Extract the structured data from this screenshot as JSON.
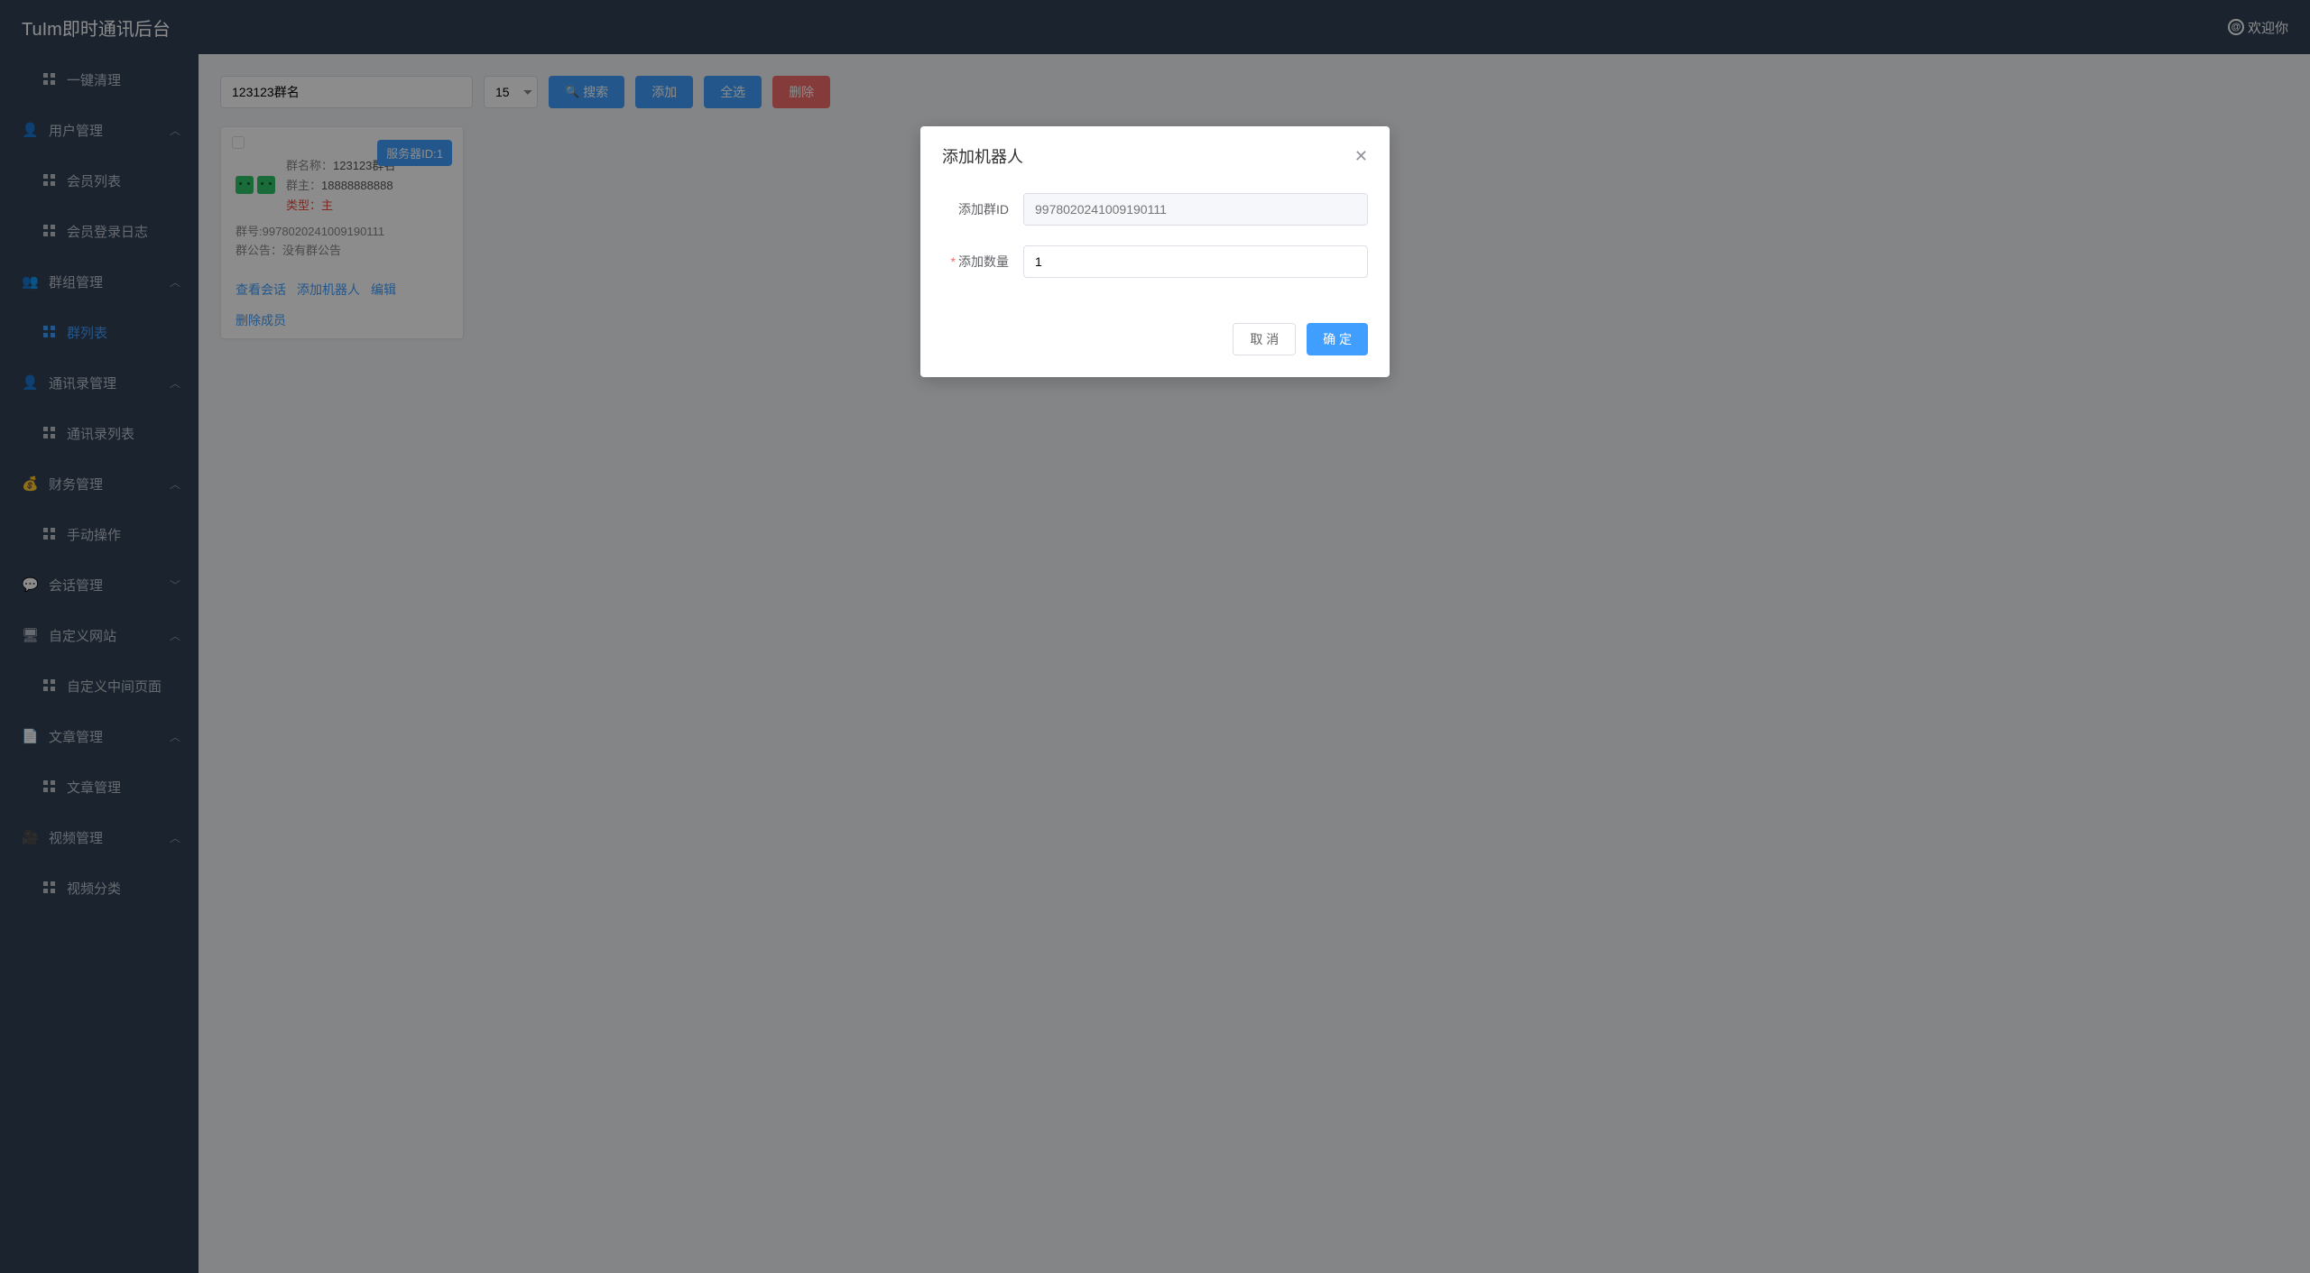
{
  "header": {
    "title": "TuIm即时通讯后台",
    "welcome": "欢迎你"
  },
  "sidebar": {
    "items": [
      {
        "type": "sub",
        "label": "一键清理",
        "name": "one-click-clean"
      },
      {
        "type": "group",
        "label": "用户管理",
        "name": "user-mgmt",
        "arrow": "︿"
      },
      {
        "type": "sub",
        "label": "会员列表",
        "name": "member-list"
      },
      {
        "type": "sub",
        "label": "会员登录日志",
        "name": "member-login-log"
      },
      {
        "type": "group",
        "label": "群组管理",
        "name": "group-mgmt",
        "arrow": "︿"
      },
      {
        "type": "sub",
        "label": "群列表",
        "name": "group-list",
        "active": true
      },
      {
        "type": "group",
        "label": "通讯录管理",
        "name": "contacts-mgmt",
        "arrow": "︿"
      },
      {
        "type": "sub",
        "label": "通讯录列表",
        "name": "contacts-list"
      },
      {
        "type": "group",
        "label": "财务管理",
        "name": "finance-mgmt",
        "arrow": "︿"
      },
      {
        "type": "sub",
        "label": "手动操作",
        "name": "manual-op"
      },
      {
        "type": "group",
        "label": "会话管理",
        "name": "session-mgmt",
        "arrow": "﹀"
      },
      {
        "type": "group",
        "label": "自定义网站",
        "name": "custom-site",
        "arrow": "︿"
      },
      {
        "type": "sub",
        "label": "自定义中间页面",
        "name": "custom-mid-page"
      },
      {
        "type": "group",
        "label": "文章管理",
        "name": "article-mgmt",
        "arrow": "︿"
      },
      {
        "type": "sub",
        "label": "文章管理",
        "name": "article-mgmt-sub"
      },
      {
        "type": "group",
        "label": "视频管理",
        "name": "video-mgmt",
        "arrow": "︿"
      },
      {
        "type": "sub",
        "label": "视频分类",
        "name": "video-category"
      }
    ]
  },
  "toolbar": {
    "search_value": "123123群名",
    "page_size": "15",
    "search_label": "搜索",
    "add_label": "添加",
    "select_all_label": "全选",
    "delete_label": "删除"
  },
  "card": {
    "server_badge": "服务器ID:1",
    "group_name_label": "群名称：",
    "group_name_value": "123123群名",
    "owner_label": "群主：",
    "owner_value": "18888888888",
    "type_label": "类型：",
    "type_value": "主",
    "id_label": "群号:",
    "id_value": "9978020241009190111",
    "notice_label": "群公告：",
    "notice_value": "没有群公告",
    "actions": {
      "view_chat": "查看会话",
      "add_robot": "添加机器人",
      "edit": "编辑",
      "remove_member": "删除成员"
    }
  },
  "modal": {
    "title": "添加机器人",
    "group_id_label": "添加群ID",
    "group_id_value": "9978020241009190111",
    "count_label": "添加数量",
    "count_value": "1",
    "cancel": "取 消",
    "confirm": "确 定"
  }
}
